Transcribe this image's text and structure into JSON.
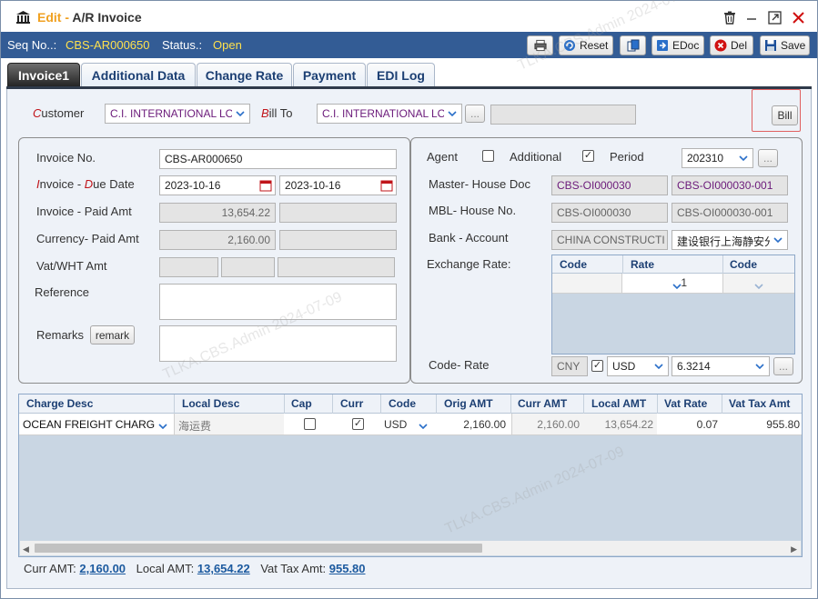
{
  "titlebar": {
    "edit": "Edit",
    "sep": "-",
    "name": "A/R Invoice"
  },
  "status": {
    "seq_label": "Seq No..:",
    "seq_value": "CBS-AR000650",
    "status_label": "Status.:",
    "status_value": "Open"
  },
  "toolbar": {
    "reset": "Reset",
    "edoc": "EDoc",
    "del": "Del",
    "save": "Save"
  },
  "tabs": [
    "Invoice1",
    "Additional Data",
    "Change Rate",
    "Payment",
    "EDI Log"
  ],
  "customer": {
    "label_r": "C",
    "label_rest": "ustomer",
    "value": "C.I. INTERNATIONAL LO",
    "bill_label_r": "B",
    "bill_label_rest": "ill To",
    "bill_value": "C.I. INTERNATIONAL LO",
    "more": "...",
    "bill_button": "Bill"
  },
  "left": {
    "invoice_no_label": "Invoice No.",
    "invoice_no": "CBS-AR000650",
    "inv_due_label": {
      "r1": "I",
      "t1": "nvoice - ",
      "r2": "D",
      "t2": "ue Date"
    },
    "invoice_date": "2023-10-16",
    "due_date": "2023-10-16",
    "inv_paid_label": "Invoice - Paid Amt",
    "invoice_amt": "13,654.22",
    "cur_paid_label": "Currency- Paid Amt",
    "currency_amt": "2,160.00",
    "vat_label": "Vat/WHT Amt",
    "reference_label": "Reference",
    "remarks_label": "Remarks",
    "remark_btn": "remark"
  },
  "right": {
    "agent_label": "Agent",
    "additional_label": "Additional",
    "period_label": "Period",
    "period": "202310",
    "master_label": "Master- House Doc",
    "master_doc": "CBS-OI000030",
    "house_doc": "CBS-OI000030-001",
    "mbl_label": "MBL- House No.",
    "mbl_no": "CBS-OI000030",
    "house_no": "CBS-OI000030-001",
    "bank_label": "Bank -  Account",
    "bank": "CHINA CONSTRUCTI",
    "account": "建设银行上海静安分",
    "exch_label": "Exchange Rate:",
    "exch_headers": [
      "Code",
      "Rate",
      "Code"
    ],
    "exch_rate": "1",
    "code_rate_label": "Code- Rate",
    "code1": "CNY",
    "code2": "USD",
    "rate": "6.3214"
  },
  "grid": {
    "headers": [
      "Charge Desc",
      "Local Desc",
      "Cap",
      "Curr",
      "Code",
      "Orig AMT",
      "Curr AMT",
      "Local AMT",
      "Vat Rate",
      "Vat Tax Amt"
    ],
    "row": {
      "charge": "OCEAN FREIGHT CHARG",
      "local": "海运费",
      "code": "USD",
      "orig": "2,160.00",
      "curr": "2,160.00",
      "localamt": "13,654.22",
      "vat_rate": "0.07",
      "vat_tax": "955.80"
    }
  },
  "footer": {
    "curr_label": "Curr AMT:",
    "curr": "2,160.00",
    "local_label": "Local AMT:",
    "local": "13,654.22",
    "vat_label": "Vat Tax Amt:",
    "vat": "955.80"
  },
  "watermark": "TLKA.CBS.Admin 2024-07-09"
}
